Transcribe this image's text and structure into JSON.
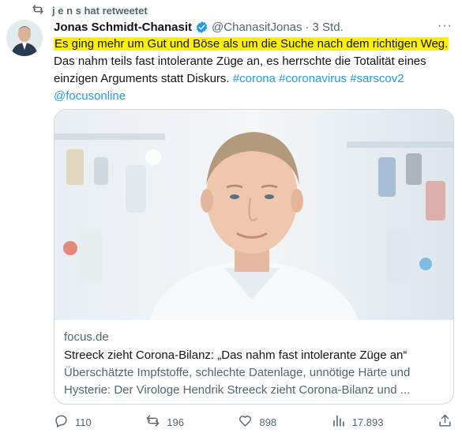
{
  "retweet": {
    "icon": "retweet-icon",
    "label": "j e n s hat retweetet"
  },
  "tweet": {
    "author_name": "Jonas Schmidt-Chanasit",
    "handle": "@ChanasitJonas",
    "separator": "·",
    "time": "3 Std.",
    "more_label": "···",
    "highlighted_text": "Es ging mehr um Gut und Böse als um die Suche nach dem richtigen Weg.",
    "text_continuation": "Das nahm teils fast intolerante Züge an, es herrschte die Totalität eines einzigen Arguments statt Diskurs.",
    "hashtags": [
      "#corona",
      "#coronavirus",
      "#sarscov2"
    ],
    "mention": "@focusonline"
  },
  "card": {
    "domain": "focus.de",
    "title": "Streeck zieht Corona-Bilanz: „Das nahm fast intolerante Züge an“",
    "description": "Überschätzte Impfstoffe, schlechte Datenlage, unnötige Härte und Hysterie: Der Virologe Hendrik Streeck zieht Corona-Bilanz und ..."
  },
  "actions": {
    "replies": "110",
    "retweets": "196",
    "likes": "898",
    "views": "17.893"
  },
  "colors": {
    "highlight": "#fff200",
    "link": "#1d9bf0",
    "muted": "#536471",
    "verified": "#1d9bf0"
  }
}
